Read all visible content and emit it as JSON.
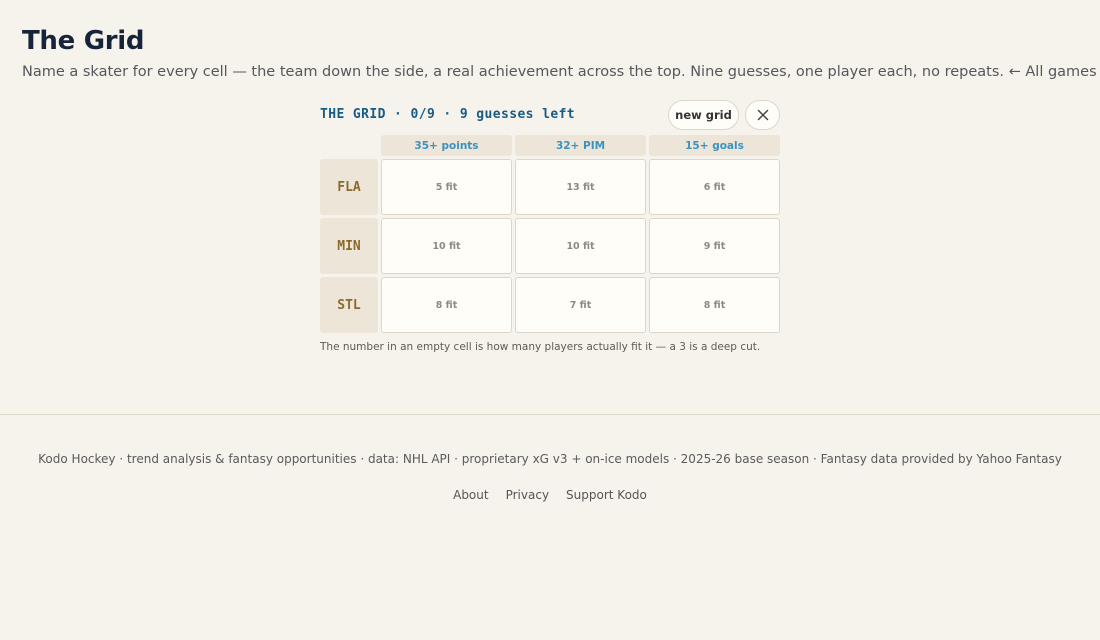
{
  "page": {
    "title": "The Grid",
    "subtitle": "Name a skater for every cell — the team down the side, a real achievement across the top. Nine guesses, one player each, no repeats.",
    "back_link": "← All games"
  },
  "game": {
    "status": "THE GRID · 0/9 · 9 guesses left",
    "new_grid_label": "new grid",
    "close_icon": "close-icon",
    "columns": [
      "35+ points",
      "32+ PIM",
      "15+ goals"
    ],
    "rows": [
      {
        "team": "FLA",
        "cells": [
          "5 fit",
          "13 fit",
          "6 fit"
        ]
      },
      {
        "team": "MIN",
        "cells": [
          "10 fit",
          "10 fit",
          "9 fit"
        ]
      },
      {
        "team": "STL",
        "cells": [
          "8 fit",
          "7 fit",
          "8 fit"
        ]
      }
    ],
    "hint": "The number in an empty cell is how many players actually fit it — a 3 is a deep cut."
  },
  "footer": {
    "text": "Kodo Hockey · trend analysis & fantasy opportunities · data: NHL API · proprietary xG v3 + on-ice models · 2025-26 base season · Fantasy data provided by Yahoo Fantasy",
    "links": [
      "About",
      "Privacy",
      "Support Kodo"
    ]
  },
  "colors": {
    "background": "#f6f3ed",
    "title": "#16243a",
    "status": "#1a5b85",
    "column_header": "#3a93bf",
    "row_header": "#8b6a2c"
  }
}
